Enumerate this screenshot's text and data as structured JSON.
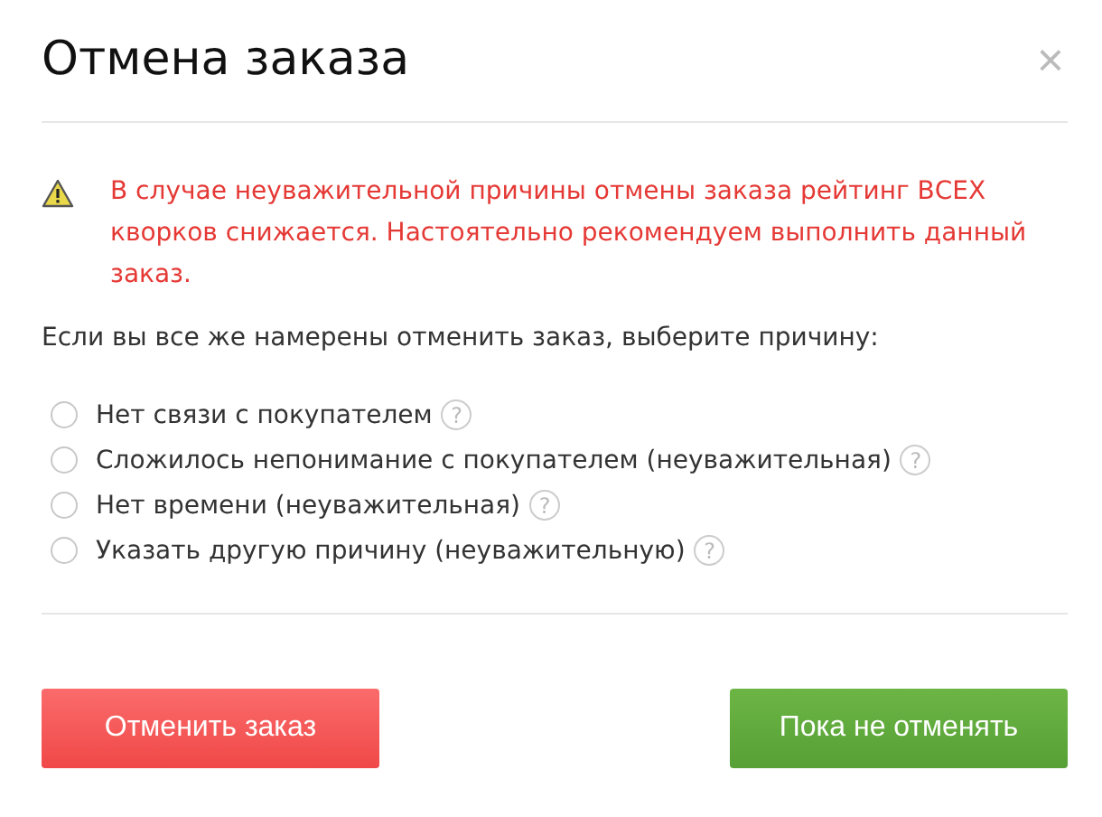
{
  "dialog": {
    "title": "Отмена заказа",
    "close": "×"
  },
  "warning": "В случае неуважительной причины отмены заказа рейтинг ВСЕХ кворков снижается. Настоятельно рекомендуем выполнить данный заказ.",
  "prompt": "Если вы все же намерены отменить заказ, выберите причину:",
  "reasons": [
    {
      "label": "Нет связи с покупателем",
      "selected": false,
      "help": "?"
    },
    {
      "label": "Сложилось непонимание с покупателем (неуважительная)",
      "selected": false,
      "help": "?"
    },
    {
      "label": "Нет времени (неуважительная)",
      "selected": false,
      "help": "?"
    },
    {
      "label": "Указать другую причину (неуважительную)",
      "selected": false,
      "help": "?"
    }
  ],
  "buttons": [
    {
      "label": "Отменить заказ",
      "kind": "danger"
    },
    {
      "label": "Пока не отменять",
      "kind": "success"
    }
  ]
}
